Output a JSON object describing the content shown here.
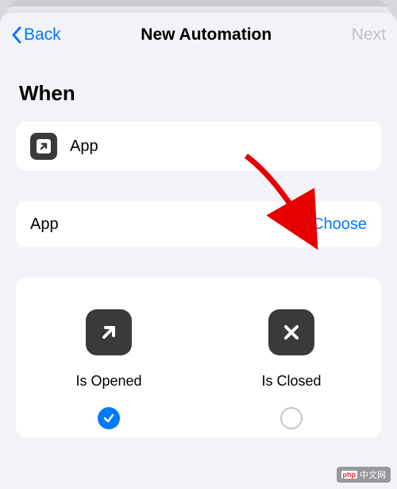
{
  "nav": {
    "back": "Back",
    "title": "New Automation",
    "next": "Next"
  },
  "section_header": "When",
  "trigger_row": {
    "icon": "app-open-icon",
    "label": "App"
  },
  "select_row": {
    "label": "App",
    "action": "Choose"
  },
  "options": {
    "opened": {
      "label": "Is Opened",
      "selected": true
    },
    "closed": {
      "label": "Is Closed",
      "selected": false
    }
  },
  "colors": {
    "accent": "#007aff",
    "icon_bg": "#3a3a3c",
    "disabled": "#c3c3c8"
  },
  "watermark": "中文网"
}
